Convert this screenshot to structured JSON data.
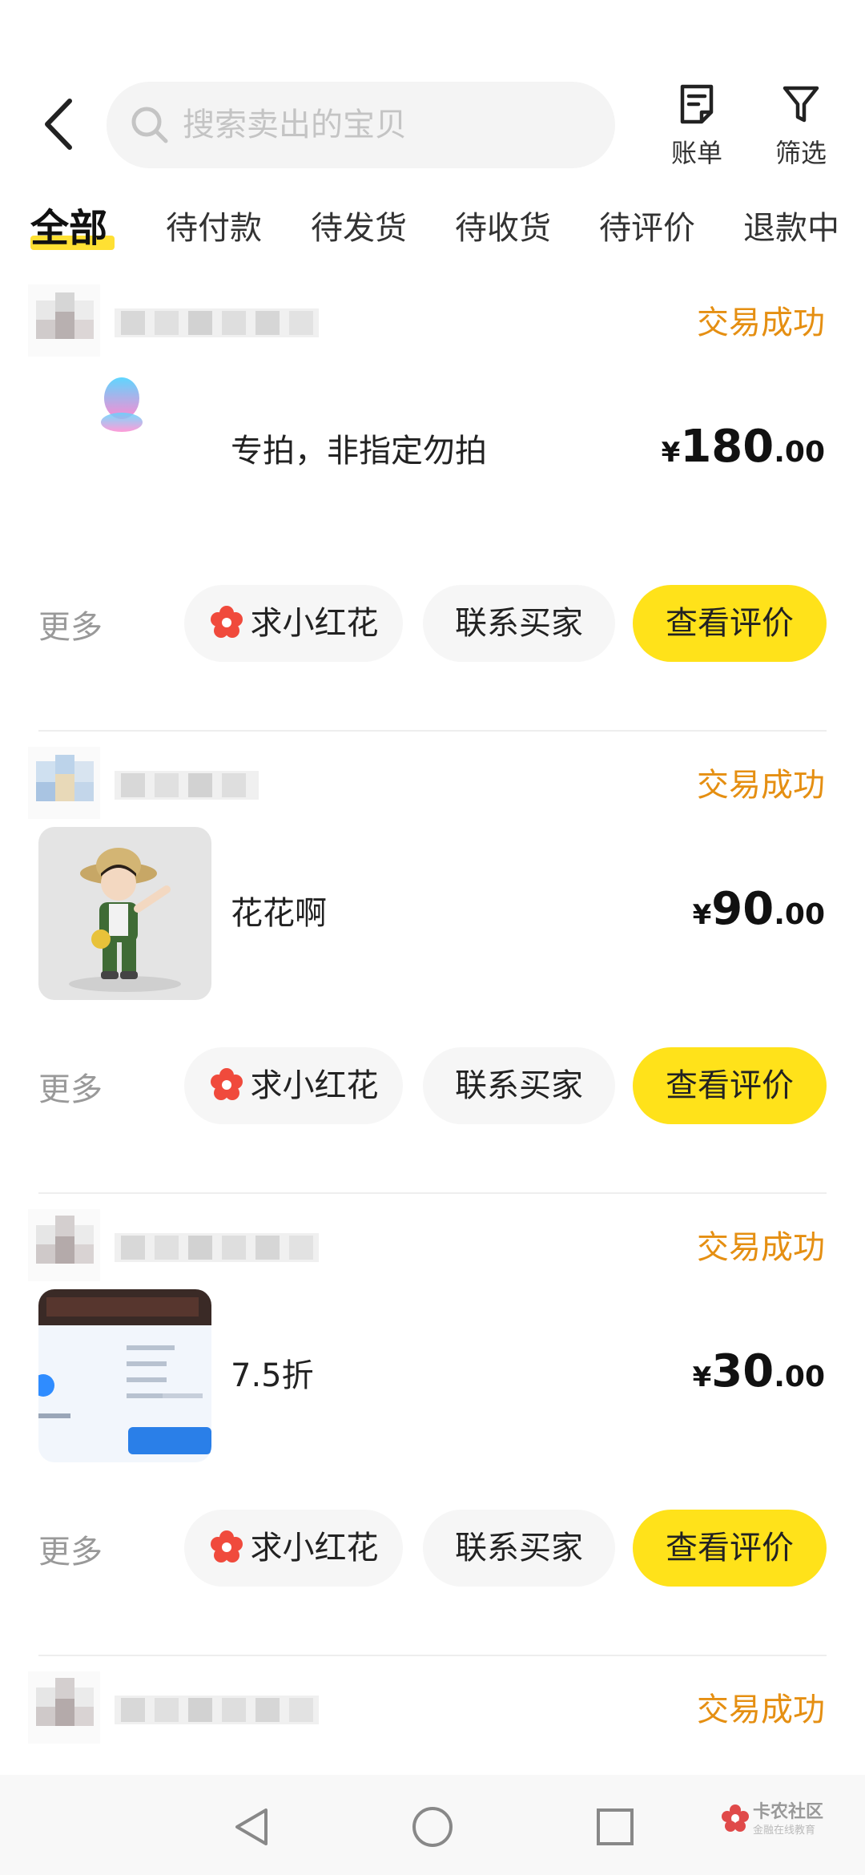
{
  "search": {
    "placeholder": "搜索卖出的宝贝"
  },
  "top_actions": [
    {
      "label": "账单",
      "icon": "bill-icon"
    },
    {
      "label": "筛选",
      "icon": "filter-icon"
    }
  ],
  "tabs": [
    "全部",
    "待付款",
    "待发货",
    "待收货",
    "待评价",
    "退款中"
  ],
  "active_tab": "全部",
  "orders": [
    {
      "status": "交易成功",
      "title": "专拍，非指定勿拍",
      "currency": "¥",
      "price_int": "180",
      "price_dec": ".00",
      "thumb": "qq-penguin-icon"
    },
    {
      "status": "交易成功",
      "title": "花花啊",
      "currency": "¥",
      "price_int": "90",
      "price_dec": ".00",
      "thumb": "figurine-photo"
    },
    {
      "status": "交易成功",
      "title": "7.5折",
      "currency": "¥",
      "price_int": "30",
      "price_dec": ".00",
      "thumb": "screenshot-photo"
    },
    {
      "status": "交易成功"
    }
  ],
  "order_actions": {
    "more": "更多",
    "ask_flower": "求小红花",
    "contact": "联系买家",
    "review": "查看评价"
  },
  "watermark": {
    "title": "卡农社区",
    "subtitle": "金融在线教育"
  },
  "colors": {
    "accent_yellow": "#ffe21a",
    "status_orange": "#e58f12",
    "flower_red": "#f04a3c"
  }
}
